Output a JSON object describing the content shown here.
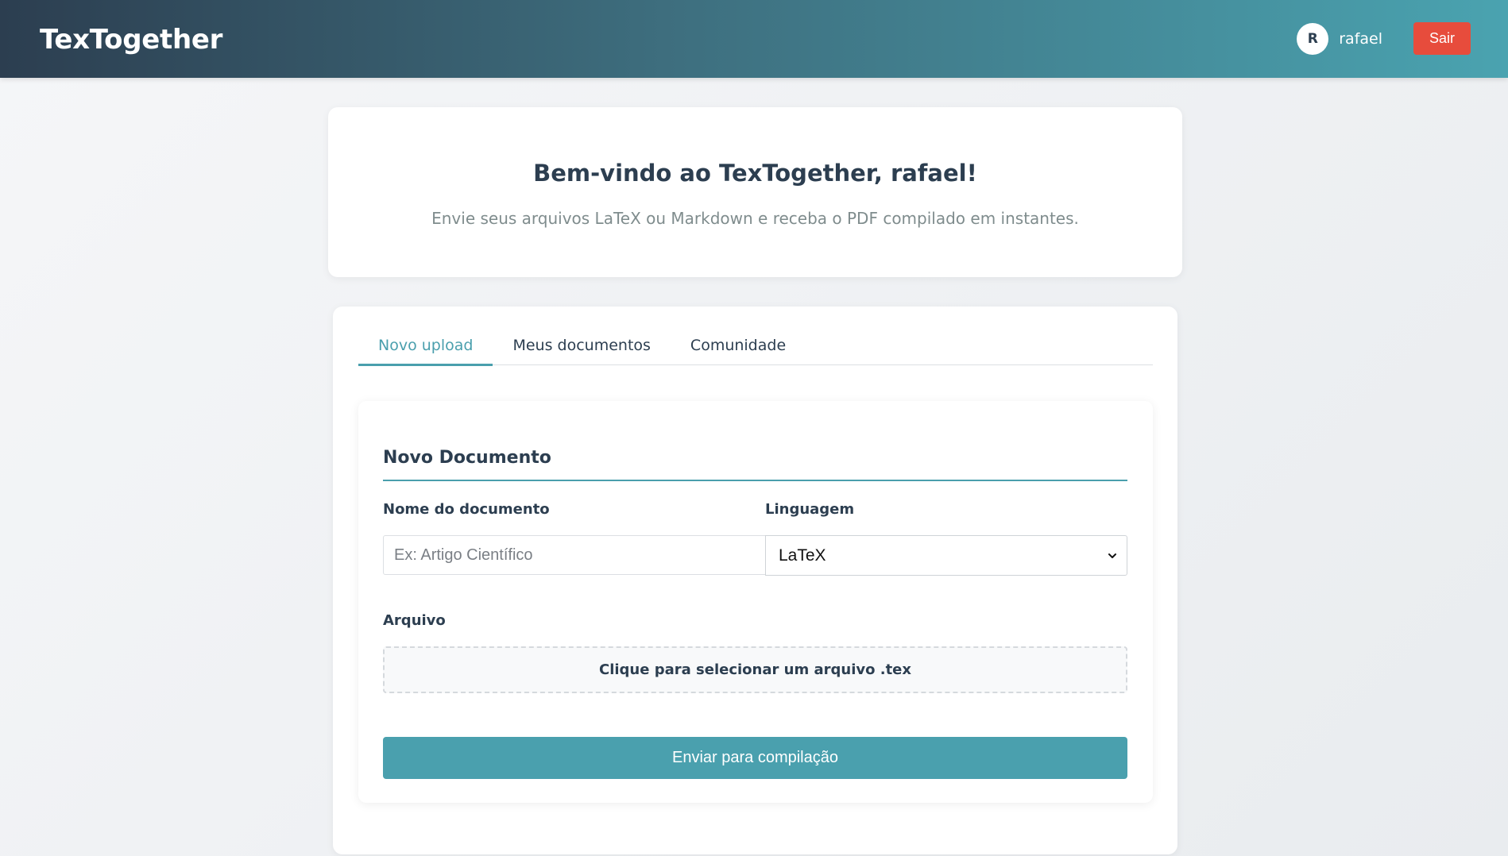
{
  "header": {
    "brand": "TexTogether",
    "user": {
      "avatar_initial": "R",
      "name": "rafael"
    },
    "logout_label": "Sair"
  },
  "welcome": {
    "title": "Bem-vindo ao TexTogether, rafael!",
    "subtitle": "Envie seus arquivos LaTeX ou Markdown e receba o PDF compilado em instantes."
  },
  "tabs": [
    {
      "label": "Novo upload",
      "active": true
    },
    {
      "label": "Meus documentos",
      "active": false
    },
    {
      "label": "Comunidade",
      "active": false
    }
  ],
  "form": {
    "title": "Novo Documento",
    "name_label": "Nome do documento",
    "name_placeholder": "Ex: Artigo Científico",
    "name_value": "",
    "language_label": "Linguagem",
    "language_selected": "LaTeX",
    "file_label": "Arquivo",
    "dropzone_text": "Clique para selecionar um arquivo .tex",
    "submit_label": "Enviar para compilação"
  },
  "colors": {
    "header_start": "#2c3e50",
    "header_end": "#4aa3b0",
    "accent": "#4a9fad",
    "logout": "#e74c3c",
    "text_dark": "#2c3e50",
    "text_muted": "#7f8c8d"
  },
  "icons": {
    "select_chevron": "chevron-down-icon"
  }
}
